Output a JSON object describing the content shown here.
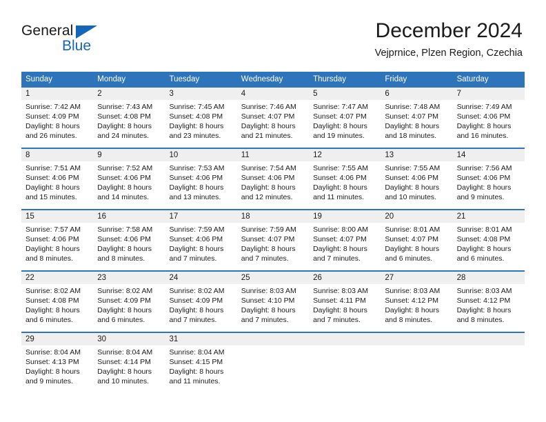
{
  "brand": {
    "name_part1": "General",
    "name_part2": "Blue",
    "accent_color": "#1565b8",
    "triangle_icon": "triangle-icon"
  },
  "header": {
    "title": "December 2024",
    "subtitle": "Vejprnice, Plzen Region, Czechia"
  },
  "theme": {
    "header_blue": "#2d74bb",
    "day_band_gray": "#efefef",
    "text_color": "#1a1a1a"
  },
  "weekday_headers": [
    "Sunday",
    "Monday",
    "Tuesday",
    "Wednesday",
    "Thursday",
    "Friday",
    "Saturday"
  ],
  "weeks": [
    {
      "days": [
        {
          "num": "1",
          "sunrise": "Sunrise: 7:42 AM",
          "sunset": "Sunset: 4:09 PM",
          "daylight_line1": "Daylight: 8 hours",
          "daylight_line2": "and 26 minutes."
        },
        {
          "num": "2",
          "sunrise": "Sunrise: 7:43 AM",
          "sunset": "Sunset: 4:08 PM",
          "daylight_line1": "Daylight: 8 hours",
          "daylight_line2": "and 24 minutes."
        },
        {
          "num": "3",
          "sunrise": "Sunrise: 7:45 AM",
          "sunset": "Sunset: 4:08 PM",
          "daylight_line1": "Daylight: 8 hours",
          "daylight_line2": "and 23 minutes."
        },
        {
          "num": "4",
          "sunrise": "Sunrise: 7:46 AM",
          "sunset": "Sunset: 4:07 PM",
          "daylight_line1": "Daylight: 8 hours",
          "daylight_line2": "and 21 minutes."
        },
        {
          "num": "5",
          "sunrise": "Sunrise: 7:47 AM",
          "sunset": "Sunset: 4:07 PM",
          "daylight_line1": "Daylight: 8 hours",
          "daylight_line2": "and 19 minutes."
        },
        {
          "num": "6",
          "sunrise": "Sunrise: 7:48 AM",
          "sunset": "Sunset: 4:07 PM",
          "daylight_line1": "Daylight: 8 hours",
          "daylight_line2": "and 18 minutes."
        },
        {
          "num": "7",
          "sunrise": "Sunrise: 7:49 AM",
          "sunset": "Sunset: 4:06 PM",
          "daylight_line1": "Daylight: 8 hours",
          "daylight_line2": "and 16 minutes."
        }
      ]
    },
    {
      "days": [
        {
          "num": "8",
          "sunrise": "Sunrise: 7:51 AM",
          "sunset": "Sunset: 4:06 PM",
          "daylight_line1": "Daylight: 8 hours",
          "daylight_line2": "and 15 minutes."
        },
        {
          "num": "9",
          "sunrise": "Sunrise: 7:52 AM",
          "sunset": "Sunset: 4:06 PM",
          "daylight_line1": "Daylight: 8 hours",
          "daylight_line2": "and 14 minutes."
        },
        {
          "num": "10",
          "sunrise": "Sunrise: 7:53 AM",
          "sunset": "Sunset: 4:06 PM",
          "daylight_line1": "Daylight: 8 hours",
          "daylight_line2": "and 13 minutes."
        },
        {
          "num": "11",
          "sunrise": "Sunrise: 7:54 AM",
          "sunset": "Sunset: 4:06 PM",
          "daylight_line1": "Daylight: 8 hours",
          "daylight_line2": "and 12 minutes."
        },
        {
          "num": "12",
          "sunrise": "Sunrise: 7:55 AM",
          "sunset": "Sunset: 4:06 PM",
          "daylight_line1": "Daylight: 8 hours",
          "daylight_line2": "and 11 minutes."
        },
        {
          "num": "13",
          "sunrise": "Sunrise: 7:55 AM",
          "sunset": "Sunset: 4:06 PM",
          "daylight_line1": "Daylight: 8 hours",
          "daylight_line2": "and 10 minutes."
        },
        {
          "num": "14",
          "sunrise": "Sunrise: 7:56 AM",
          "sunset": "Sunset: 4:06 PM",
          "daylight_line1": "Daylight: 8 hours",
          "daylight_line2": "and 9 minutes."
        }
      ]
    },
    {
      "days": [
        {
          "num": "15",
          "sunrise": "Sunrise: 7:57 AM",
          "sunset": "Sunset: 4:06 PM",
          "daylight_line1": "Daylight: 8 hours",
          "daylight_line2": "and 8 minutes."
        },
        {
          "num": "16",
          "sunrise": "Sunrise: 7:58 AM",
          "sunset": "Sunset: 4:06 PM",
          "daylight_line1": "Daylight: 8 hours",
          "daylight_line2": "and 8 minutes."
        },
        {
          "num": "17",
          "sunrise": "Sunrise: 7:59 AM",
          "sunset": "Sunset: 4:06 PM",
          "daylight_line1": "Daylight: 8 hours",
          "daylight_line2": "and 7 minutes."
        },
        {
          "num": "18",
          "sunrise": "Sunrise: 7:59 AM",
          "sunset": "Sunset: 4:07 PM",
          "daylight_line1": "Daylight: 8 hours",
          "daylight_line2": "and 7 minutes."
        },
        {
          "num": "19",
          "sunrise": "Sunrise: 8:00 AM",
          "sunset": "Sunset: 4:07 PM",
          "daylight_line1": "Daylight: 8 hours",
          "daylight_line2": "and 7 minutes."
        },
        {
          "num": "20",
          "sunrise": "Sunrise: 8:01 AM",
          "sunset": "Sunset: 4:07 PM",
          "daylight_line1": "Daylight: 8 hours",
          "daylight_line2": "and 6 minutes."
        },
        {
          "num": "21",
          "sunrise": "Sunrise: 8:01 AM",
          "sunset": "Sunset: 4:08 PM",
          "daylight_line1": "Daylight: 8 hours",
          "daylight_line2": "and 6 minutes."
        }
      ]
    },
    {
      "days": [
        {
          "num": "22",
          "sunrise": "Sunrise: 8:02 AM",
          "sunset": "Sunset: 4:08 PM",
          "daylight_line1": "Daylight: 8 hours",
          "daylight_line2": "and 6 minutes."
        },
        {
          "num": "23",
          "sunrise": "Sunrise: 8:02 AM",
          "sunset": "Sunset: 4:09 PM",
          "daylight_line1": "Daylight: 8 hours",
          "daylight_line2": "and 6 minutes."
        },
        {
          "num": "24",
          "sunrise": "Sunrise: 8:02 AM",
          "sunset": "Sunset: 4:09 PM",
          "daylight_line1": "Daylight: 8 hours",
          "daylight_line2": "and 7 minutes."
        },
        {
          "num": "25",
          "sunrise": "Sunrise: 8:03 AM",
          "sunset": "Sunset: 4:10 PM",
          "daylight_line1": "Daylight: 8 hours",
          "daylight_line2": "and 7 minutes."
        },
        {
          "num": "26",
          "sunrise": "Sunrise: 8:03 AM",
          "sunset": "Sunset: 4:11 PM",
          "daylight_line1": "Daylight: 8 hours",
          "daylight_line2": "and 7 minutes."
        },
        {
          "num": "27",
          "sunrise": "Sunrise: 8:03 AM",
          "sunset": "Sunset: 4:12 PM",
          "daylight_line1": "Daylight: 8 hours",
          "daylight_line2": "and 8 minutes."
        },
        {
          "num": "28",
          "sunrise": "Sunrise: 8:03 AM",
          "sunset": "Sunset: 4:12 PM",
          "daylight_line1": "Daylight: 8 hours",
          "daylight_line2": "and 8 minutes."
        }
      ]
    },
    {
      "days": [
        {
          "num": "29",
          "sunrise": "Sunrise: 8:04 AM",
          "sunset": "Sunset: 4:13 PM",
          "daylight_line1": "Daylight: 8 hours",
          "daylight_line2": "and 9 minutes."
        },
        {
          "num": "30",
          "sunrise": "Sunrise: 8:04 AM",
          "sunset": "Sunset: 4:14 PM",
          "daylight_line1": "Daylight: 8 hours",
          "daylight_line2": "and 10 minutes."
        },
        {
          "num": "31",
          "sunrise": "Sunrise: 8:04 AM",
          "sunset": "Sunset: 4:15 PM",
          "daylight_line1": "Daylight: 8 hours",
          "daylight_line2": "and 11 minutes."
        },
        {
          "num": "",
          "sunrise": "",
          "sunset": "",
          "daylight_line1": "",
          "daylight_line2": ""
        },
        {
          "num": "",
          "sunrise": "",
          "sunset": "",
          "daylight_line1": "",
          "daylight_line2": ""
        },
        {
          "num": "",
          "sunrise": "",
          "sunset": "",
          "daylight_line1": "",
          "daylight_line2": ""
        },
        {
          "num": "",
          "sunrise": "",
          "sunset": "",
          "daylight_line1": "",
          "daylight_line2": ""
        }
      ]
    }
  ]
}
